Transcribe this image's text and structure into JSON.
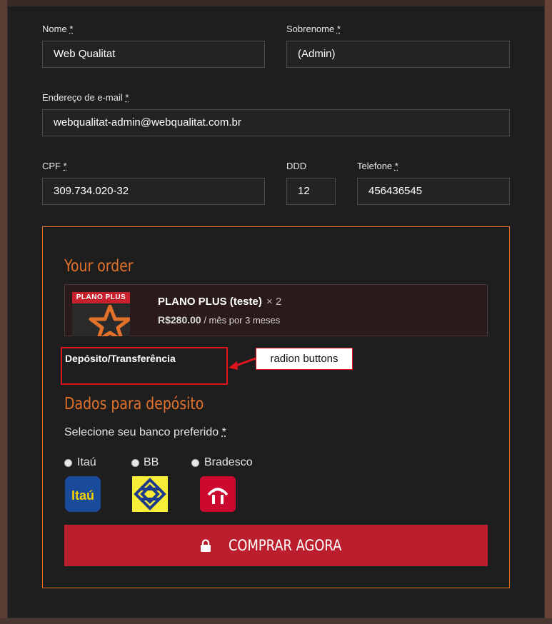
{
  "form": {
    "first_name_label": "Nome",
    "last_name_label": "Sobrenome",
    "email_label": "Endereço de e-mail",
    "cpf_label": "CPF",
    "ddd_label": "DDD",
    "phone_label": "Telefone",
    "required_mark": "*",
    "first_name_value": "Web Qualitat",
    "last_name_value": "(Admin)",
    "email_value": "webqualitat-admin@webqualitat.com.br",
    "cpf_value": "309.734.020-32",
    "ddd_value": "12",
    "phone_value": "456436545"
  },
  "order": {
    "heading": "Your order",
    "product_thumb_label": "PLANO PLUS",
    "product_name": "PLANO PLUS (teste)",
    "product_qty": "× 2",
    "product_price": "R$280.00",
    "product_period": " / mês por 3 meses"
  },
  "payment": {
    "method_label": "Depósito/Transferência"
  },
  "annotation": {
    "callout": "radion buttons"
  },
  "deposit": {
    "heading": "Dados para depósito",
    "prompt": "Selecione seu banco preferido",
    "banks": [
      {
        "label": "Itaú",
        "logo_text": "Itaú"
      },
      {
        "label": "BB"
      },
      {
        "label": "Bradesco"
      }
    ]
  },
  "checkout": {
    "button_label": "COMPRAR AGORA"
  },
  "colors": {
    "accent": "#e2712a",
    "button": "#bb1f2e",
    "annotation": "#e0141e"
  }
}
